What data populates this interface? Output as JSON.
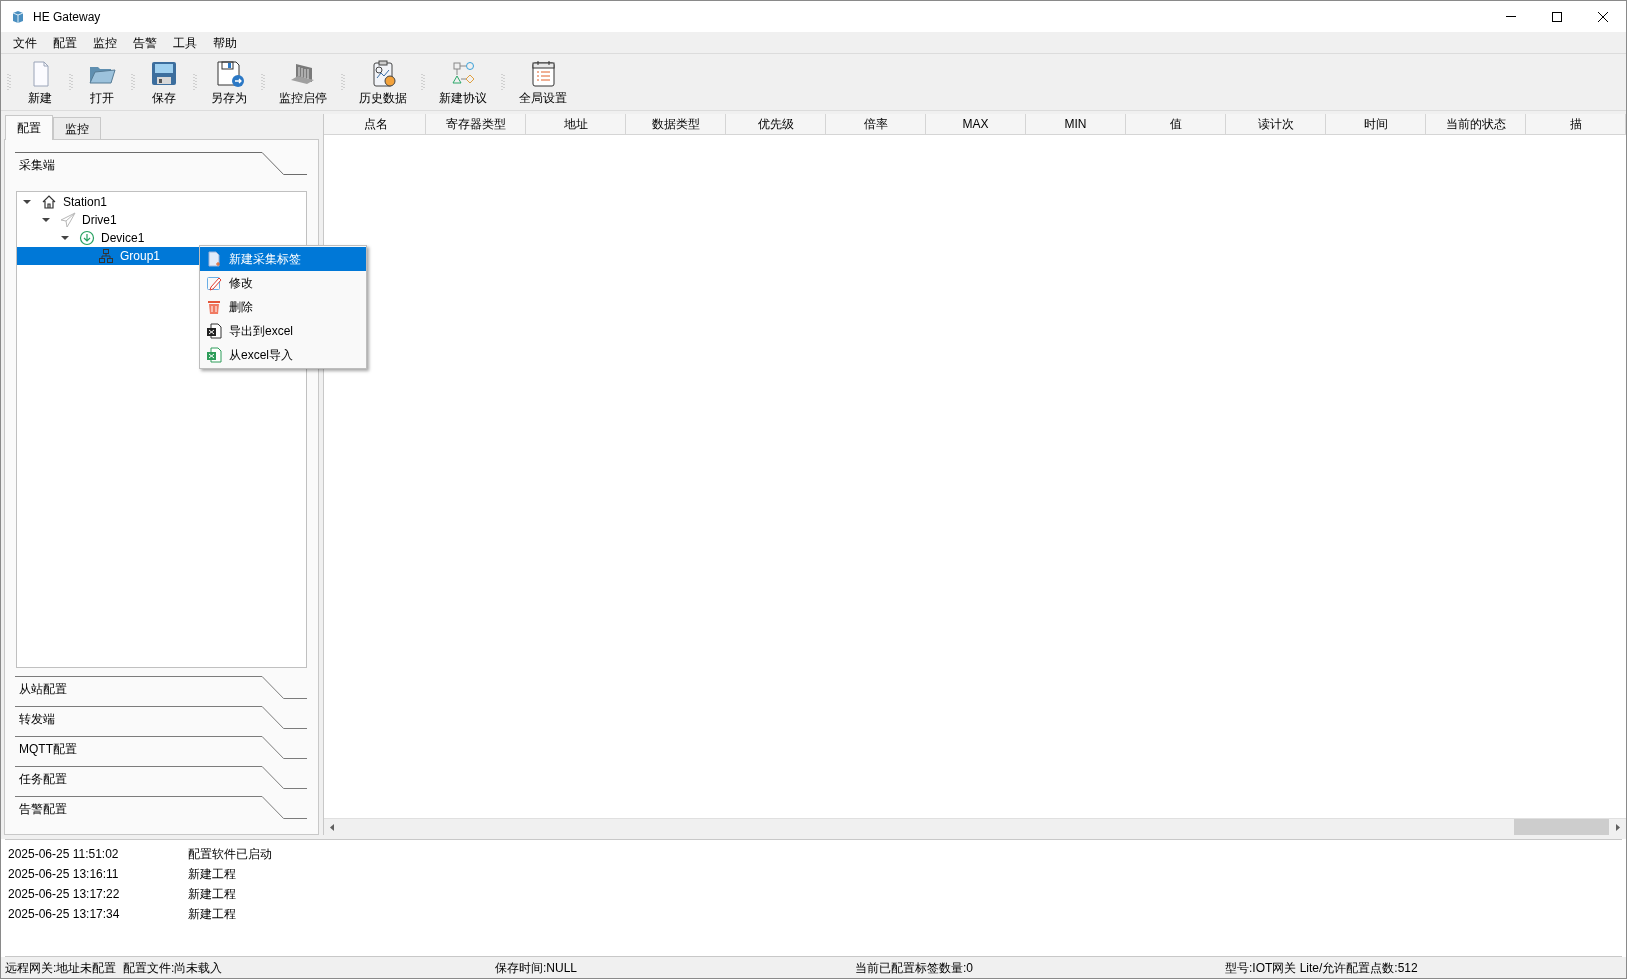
{
  "window": {
    "title": "HE Gateway"
  },
  "menu": [
    "文件",
    "配置",
    "监控",
    "告警",
    "工具",
    "帮助"
  ],
  "toolbar": [
    {
      "label": "新建",
      "kind": "new"
    },
    {
      "label": "打开",
      "kind": "open"
    },
    {
      "label": "保存",
      "kind": "save"
    },
    {
      "label": "另存为",
      "kind": "saveas"
    },
    {
      "label": "监控启停",
      "kind": "monitor"
    },
    {
      "label": "历史数据",
      "kind": "history"
    },
    {
      "label": "新建协议",
      "kind": "protocol"
    },
    {
      "label": "全局设置",
      "kind": "settings"
    }
  ],
  "left_tabs": [
    {
      "label": "配置",
      "selected": true
    },
    {
      "label": "监控",
      "selected": false
    }
  ],
  "sections": [
    {
      "title": "采集端",
      "expanded": true,
      "tree": [
        {
          "label": "Station1",
          "kind": "station",
          "expanded": true,
          "selected": false,
          "children": [
            {
              "label": "Drive1",
              "kind": "driver",
              "expanded": true,
              "selected": false,
              "children": [
                {
                  "label": "Device1",
                  "kind": "device",
                  "expanded": true,
                  "selected": false,
                  "children": [
                    {
                      "label": "Group1",
                      "kind": "group",
                      "selected": true
                    }
                  ]
                }
              ]
            }
          ]
        }
      ]
    },
    {
      "title": "从站配置",
      "expanded": false
    },
    {
      "title": "转发端",
      "expanded": false
    },
    {
      "title": "MQTT配置",
      "expanded": false
    },
    {
      "title": "任务配置",
      "expanded": false
    },
    {
      "title": "告警配置",
      "expanded": false
    }
  ],
  "context_menu": [
    {
      "label": "新建采集标签",
      "kind": "new",
      "selected": true
    },
    {
      "label": "修改",
      "kind": "edit",
      "selected": false
    },
    {
      "label": "删除",
      "kind": "delete",
      "selected": false
    },
    {
      "label": "导出到excel",
      "kind": "export",
      "selected": false
    },
    {
      "label": "从excel导入",
      "kind": "import",
      "selected": false
    }
  ],
  "table": {
    "columns": [
      "点名",
      "寄存器类型",
      "地址",
      "数据类型",
      "优先级",
      "倍率",
      "MAX",
      "MIN",
      "值",
      "读计次",
      "时间",
      "当前的状态",
      "描"
    ]
  },
  "log": [
    {
      "time": "2025-06-25 11:51:02",
      "message": "配置软件已启动"
    },
    {
      "time": "2025-06-25 13:16:11",
      "message": "新建工程"
    },
    {
      "time": "2025-06-25 13:17:22",
      "message": "新建工程"
    },
    {
      "time": "2025-06-25 13:17:34",
      "message": "新建工程"
    }
  ],
  "status_bar": [
    "远程网关:地址未配置  配置文件:尚未载入",
    "保存时间:NULL",
    "当前已配置标签数量:0",
    "型号:IOT网关 Lite/允许配置点数:512"
  ]
}
